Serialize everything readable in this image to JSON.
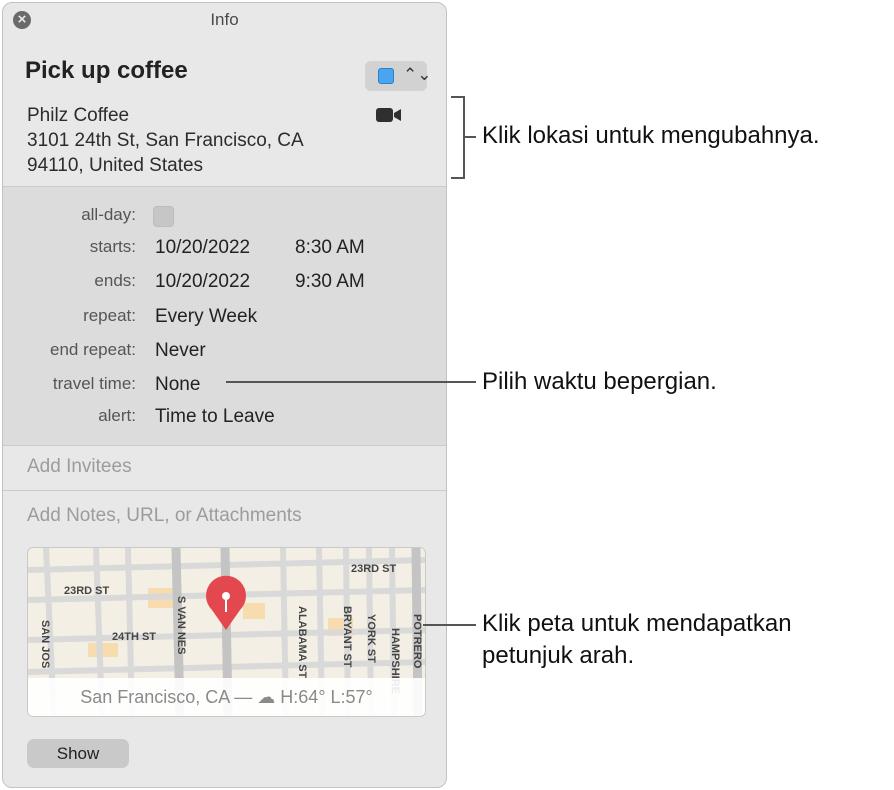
{
  "window": {
    "title": "Info",
    "close_glyph": "×"
  },
  "event": {
    "title": "Pick up coffee",
    "calendar_color": "#4aa5ee",
    "stepper_glyph": "⌃⌄",
    "location_name": "Philz Coffee",
    "location_line1": "3101 24th St, San Francisco, CA",
    "location_line2": "94110, United States"
  },
  "fields": {
    "allday_label": "all-day:",
    "starts_label": "starts:",
    "starts_date": "10/20/2022",
    "starts_time": "8:30 AM",
    "ends_label": "ends:",
    "ends_date": "10/20/2022",
    "ends_time": "9:30 AM",
    "repeat_label": "repeat:",
    "repeat_value": "Every Week",
    "end_repeat_label": "end repeat:",
    "end_repeat_value": "Never",
    "travel_label": "travel time:",
    "travel_value": "None",
    "alert_label": "alert:",
    "alert_value": "Time to Leave"
  },
  "invitees_placeholder": "Add Invitees",
  "notes_placeholder": "Add Notes, URL, or Attachments",
  "map": {
    "streets": [
      "23RD ST",
      "23RD ST",
      "24TH ST",
      "S VAN NES",
      "ALABAMA ST",
      "BRYANT ST",
      "YORK ST",
      "HAMPSHIRE",
      "POTRERO",
      "SAN JOS"
    ],
    "caption": "San Francisco, CA — ☁ H:64° L:57°"
  },
  "show_button": "Show",
  "callouts": {
    "location": "Klik lokasi untuk mengubahnya.",
    "travel": "Pilih waktu bepergian.",
    "map_line1": "Klik peta untuk mendapatkan",
    "map_line2": "petunjuk arah."
  }
}
